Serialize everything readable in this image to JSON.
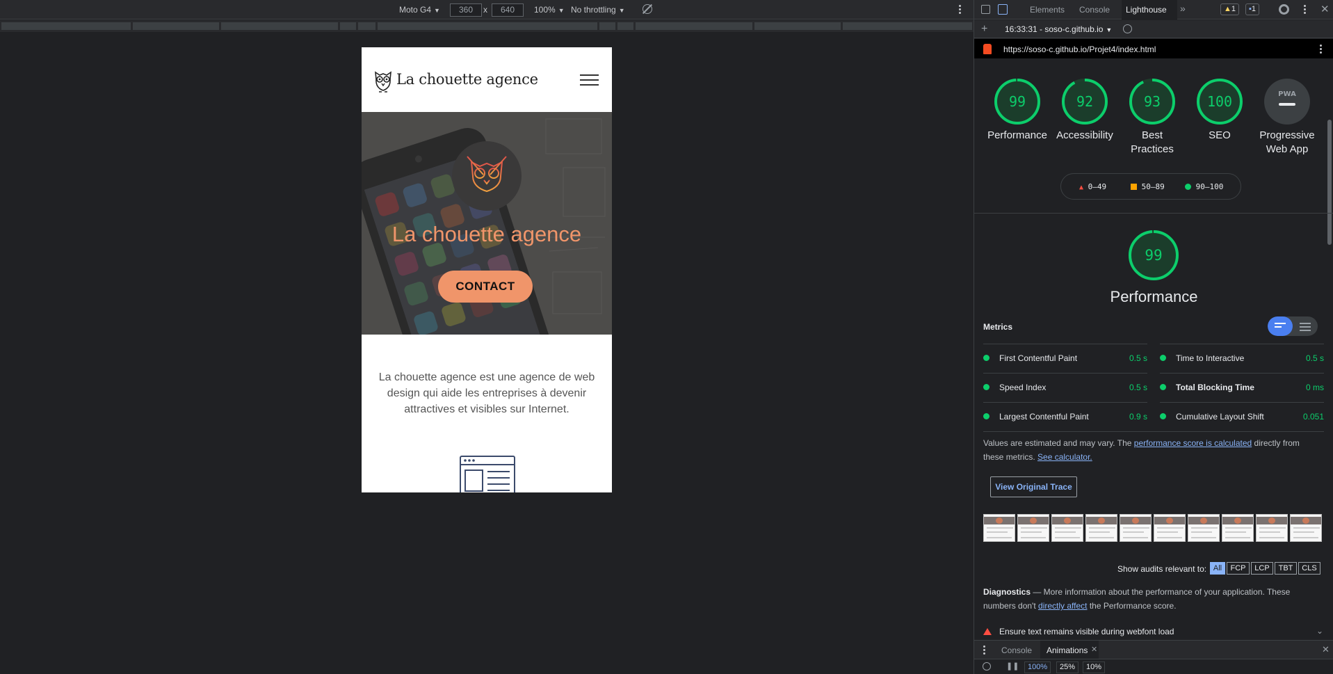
{
  "device_toolbar": {
    "device_label": "Moto G4",
    "width_value": "360",
    "times_sign": "x",
    "height_value": "640",
    "zoom_label": "100%",
    "throttling_label": "No throttling"
  },
  "site": {
    "logo_text": "La chouette agence",
    "hero_title": "La chouette agence",
    "contact_label": "CONTACT",
    "intro_text": "La chouette agence est une agence de web design qui aide les entreprises à devenir attractives et visibles sur Internet."
  },
  "devtools": {
    "tabs": [
      "Elements",
      "Console",
      "Lighthouse"
    ],
    "more_tabs": "»",
    "warnings_count": "1",
    "messages_count": "1",
    "report_selector": "16:33:31 - soso-c.github.io",
    "add_label": "+",
    "url": "https://soso-c.github.io/Projet4/index.html"
  },
  "lighthouse": {
    "categories": [
      {
        "score": "99",
        "label_lines": [
          "Performance"
        ]
      },
      {
        "score": "92",
        "label_lines": [
          "Accessibility"
        ]
      },
      {
        "score": "93",
        "label_lines": [
          "Best",
          "Practices"
        ]
      },
      {
        "score": "100",
        "label_lines": [
          "SEO"
        ]
      },
      {
        "score": "PWA",
        "label_lines": [
          "Progressive",
          "Web App"
        ]
      }
    ],
    "legend": {
      "fail": "0–49",
      "average": "50–89",
      "pass": "90–100"
    },
    "performance_score": "99",
    "performance_title": "Performance",
    "metrics_title": "Metrics",
    "metrics": [
      {
        "label": "First Contentful Paint",
        "value": "0.5 s"
      },
      {
        "label": "Time to Interactive",
        "value": "0.5 s"
      },
      {
        "label": "Speed Index",
        "value": "0.5 s"
      },
      {
        "label": "Total Blocking Time",
        "value": "0 ms"
      },
      {
        "label": "Largest Contentful Paint",
        "value": "0.9 s"
      },
      {
        "label": "Cumulative Layout Shift",
        "value": "0.051"
      }
    ],
    "values_note_1": "Values are estimated and may vary. The ",
    "values_note_link": "performance score is calculated",
    "values_note_2": " directly from these metrics. ",
    "calculator_link": "See calculator.",
    "view_trace_label": "View Original Trace",
    "show_audits_label": "Show audits relevant to:",
    "filters": [
      "All",
      "FCP",
      "LCP",
      "TBT",
      "CLS"
    ],
    "diagnostics_title": "Diagnostics",
    "diagnostics_text_1": " — More information about the performance of your application. These numbers don't ",
    "diagnostics_link": "directly affect",
    "diagnostics_text_2": " the Performance score.",
    "first_audit": "Ensure text remains visible during webfont load"
  },
  "drawer": {
    "tabs": [
      "Console",
      "Animations"
    ],
    "speeds": [
      "100%",
      "25%",
      "10%"
    ]
  },
  "colors": {
    "pass": "#0cce6b",
    "average": "#ffa400",
    "fail": "#ff4e42",
    "accent": "#f0956a"
  }
}
